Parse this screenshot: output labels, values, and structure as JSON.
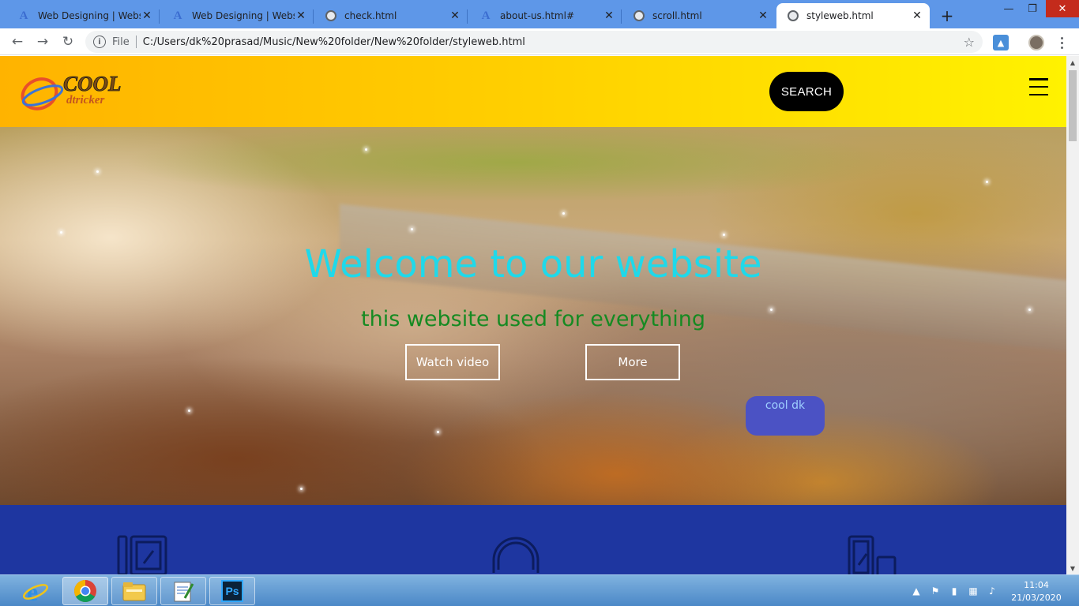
{
  "browser": {
    "tabs": [
      {
        "title": "Web Designing | Website",
        "favicon": "at-icon"
      },
      {
        "title": "Web Designing | Website",
        "favicon": "at-icon"
      },
      {
        "title": "check.html",
        "favicon": "globe-icon"
      },
      {
        "title": "about-us.html#",
        "favicon": "at-icon"
      },
      {
        "title": "scroll.html",
        "favicon": "globe-icon"
      },
      {
        "title": "styleweb.html",
        "favicon": "globe-icon",
        "active": true
      }
    ],
    "omnibox": {
      "scheme_label": "File",
      "url": "C:/Users/dk%20prasad/Music/New%20folder/New%20folder/styleweb.html"
    }
  },
  "site": {
    "logo": {
      "word1": "COOL",
      "word2": "dtricker"
    },
    "search_label": "SEARCH",
    "hero": {
      "title": "Welcome to our website",
      "subtitle": "this website used for everything",
      "watch_label": "Watch video",
      "more_label": "More",
      "badge_label": "cool dk"
    },
    "services_icons": [
      "tablet-pen-icon",
      "headphones-icon",
      "mobile-edit-icon"
    ]
  },
  "taskbar": {
    "apps": [
      "internet-explorer-icon",
      "chrome-icon",
      "file-explorer-icon",
      "notepad-icon",
      "photoshop-icon"
    ],
    "photoshop_label": "Ps",
    "time": "11:04",
    "date": "21/03/2020"
  },
  "colors": {
    "title_color": "#1fd9ea",
    "subtitle_color": "#168a22",
    "header_gradient": [
      "#ffb300",
      "#fff200"
    ],
    "services_bg": "#1e36a0",
    "badge_bg": "#4b52c4"
  }
}
